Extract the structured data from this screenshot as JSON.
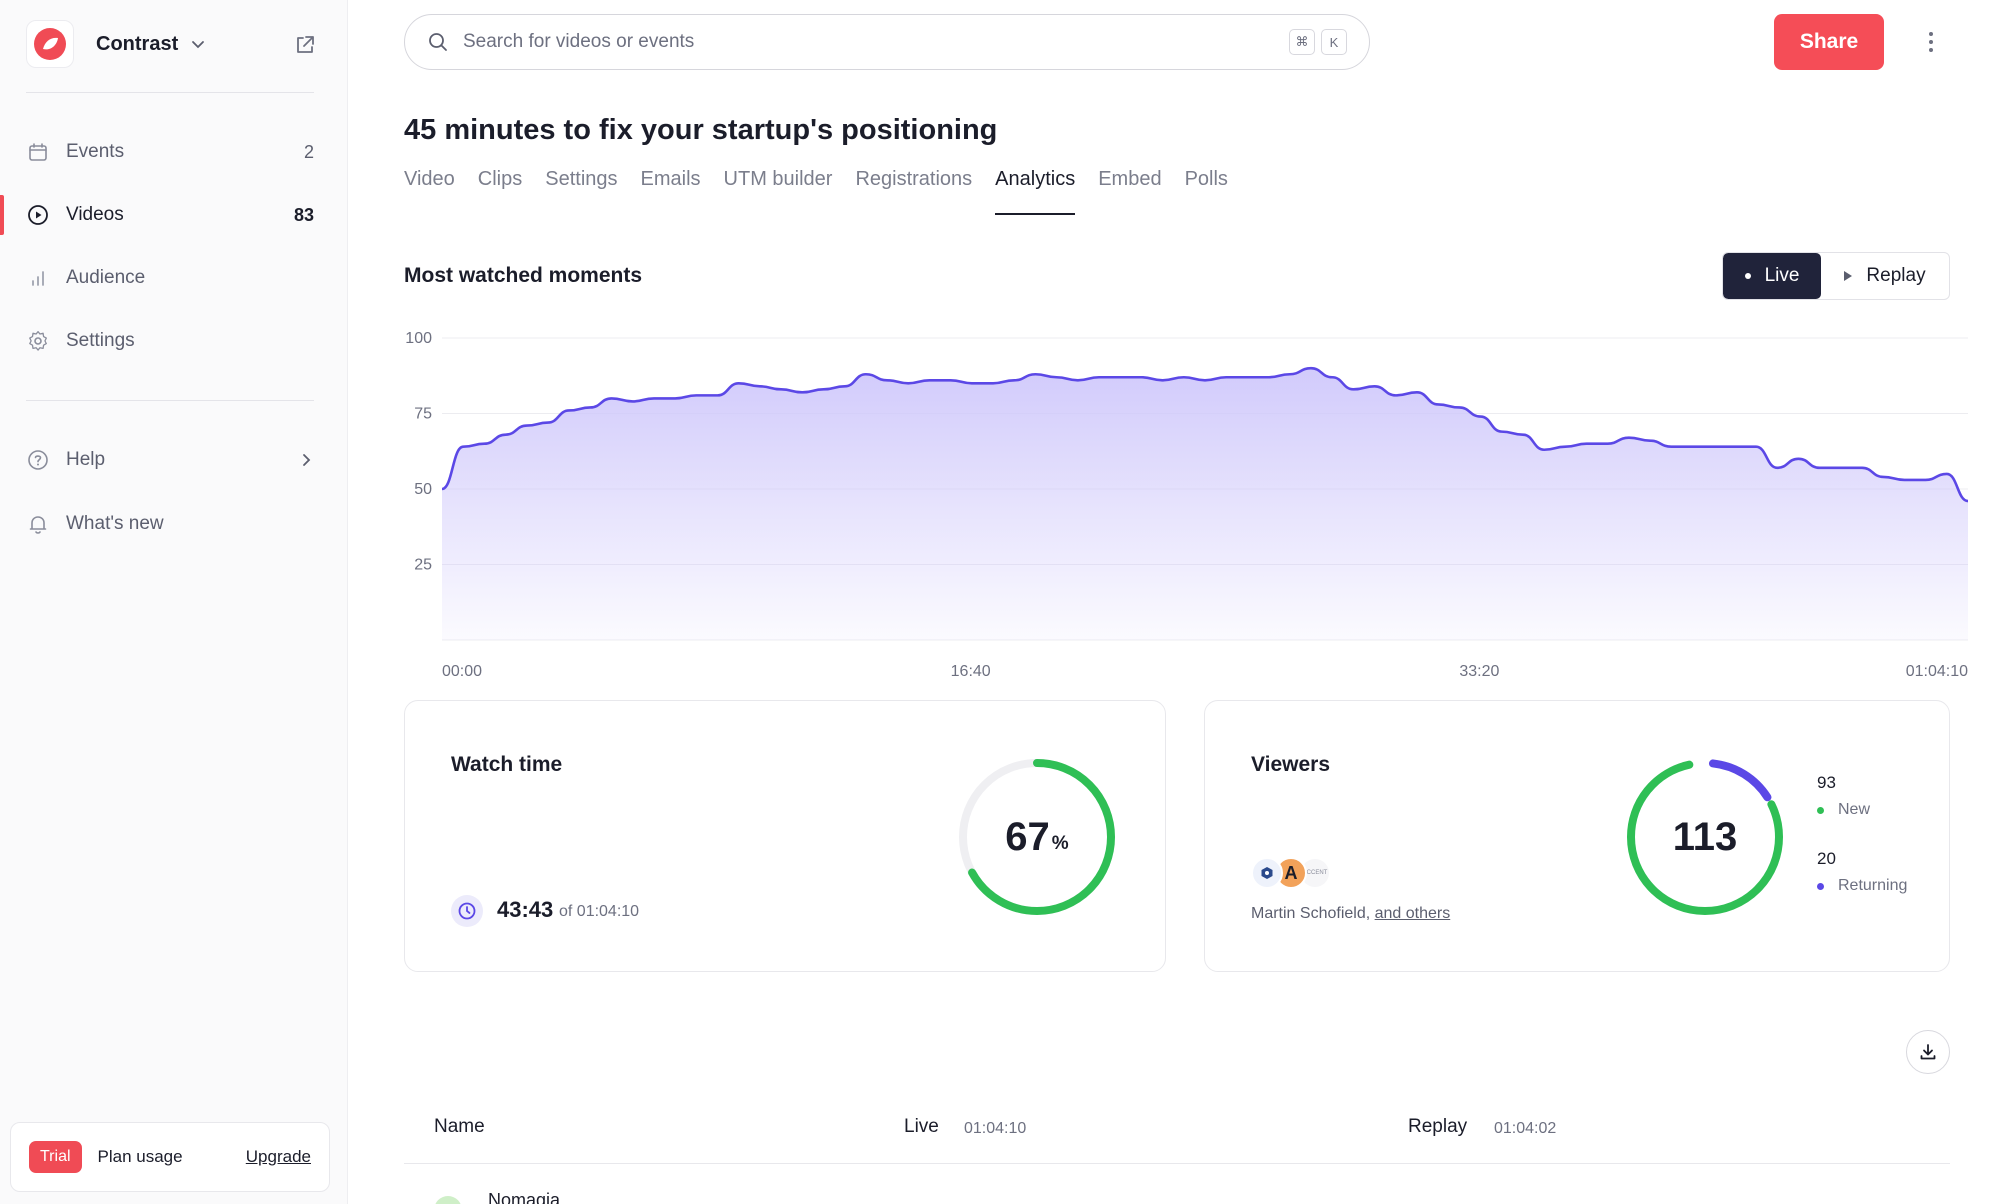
{
  "app": {
    "name": "Contrast",
    "brand_color": "#f04b55"
  },
  "sidebar": {
    "items": [
      {
        "label": "Events",
        "count": "2",
        "icon": "calendar-icon"
      },
      {
        "label": "Videos",
        "count": "83",
        "icon": "play-circle-icon",
        "active": true
      },
      {
        "label": "Audience",
        "count": "",
        "icon": "bar-chart-icon"
      },
      {
        "label": "Settings",
        "count": "",
        "icon": "gear-icon"
      }
    ],
    "help_label": "Help",
    "whats_new_label": "What's new",
    "plan": {
      "badge": "Trial",
      "label": "Plan usage",
      "upgrade": "Upgrade"
    }
  },
  "search": {
    "placeholder": "Search for videos or events",
    "shortcut_1": "⌘",
    "shortcut_2": "K"
  },
  "header": {
    "share_label": "Share",
    "title": "45 minutes to fix your startup's positioning"
  },
  "tabs": [
    "Video",
    "Clips",
    "Settings",
    "Emails",
    "UTM builder",
    "Registrations",
    "Analytics",
    "Embed",
    "Polls"
  ],
  "active_tab": "Analytics",
  "moments": {
    "title": "Most watched moments",
    "toggle_live": "Live",
    "toggle_replay": "Replay"
  },
  "chart_data": {
    "type": "area",
    "title": "Most watched moments",
    "y_ticks": [
      "100",
      "75",
      "50",
      "25"
    ],
    "ylim": [
      0,
      100
    ],
    "x_ticks": [
      "00:00",
      "16:40",
      "33:20",
      "01:04:10"
    ],
    "xlim_seconds": [
      0,
      3850
    ],
    "grid": true,
    "line_color": "#5b48e6",
    "fill_color": "#d7d2fb",
    "series": [
      {
        "values": [
          50,
          64,
          65,
          68,
          71,
          72,
          76,
          77,
          80,
          79,
          80,
          80,
          81,
          81,
          85,
          84,
          83,
          82,
          83,
          84,
          88,
          86,
          85,
          86,
          86,
          85,
          85,
          86,
          88,
          87,
          86,
          87,
          87,
          87,
          86,
          87,
          86,
          87,
          87,
          87,
          88,
          90,
          87,
          83,
          84,
          81,
          82,
          78,
          77,
          74,
          69,
          68,
          63,
          64,
          65,
          65,
          67,
          66,
          64,
          64,
          64,
          64,
          64,
          57,
          60,
          57,
          57,
          57,
          54,
          53,
          53,
          55,
          46
        ]
      }
    ]
  },
  "watch_time": {
    "title": "Watch time",
    "percent": 67,
    "percent_label": "67",
    "percent_sign": "%",
    "value": "43:43",
    "of_label": "of 01:04:10",
    "ring_color": "#2fbf55"
  },
  "viewers": {
    "title": "Viewers",
    "total": "113",
    "names": "Martin Schofield,",
    "others_link": "and others",
    "new_count": "93",
    "new_label": "New",
    "new_color": "#2fbf55",
    "returning_count": "20",
    "returning_label": "Returning",
    "returning_color": "#5b48e6",
    "new_fraction": 0.823,
    "avatar_letter": "A",
    "avatar_small_text": "ACCENT"
  },
  "table": {
    "col_name": "Name",
    "col_live": "Live",
    "col_live_time": "01:04:10",
    "col_replay": "Replay",
    "col_replay_time": "01:04:02",
    "rows": [
      {
        "name": "Nomagia"
      }
    ]
  }
}
